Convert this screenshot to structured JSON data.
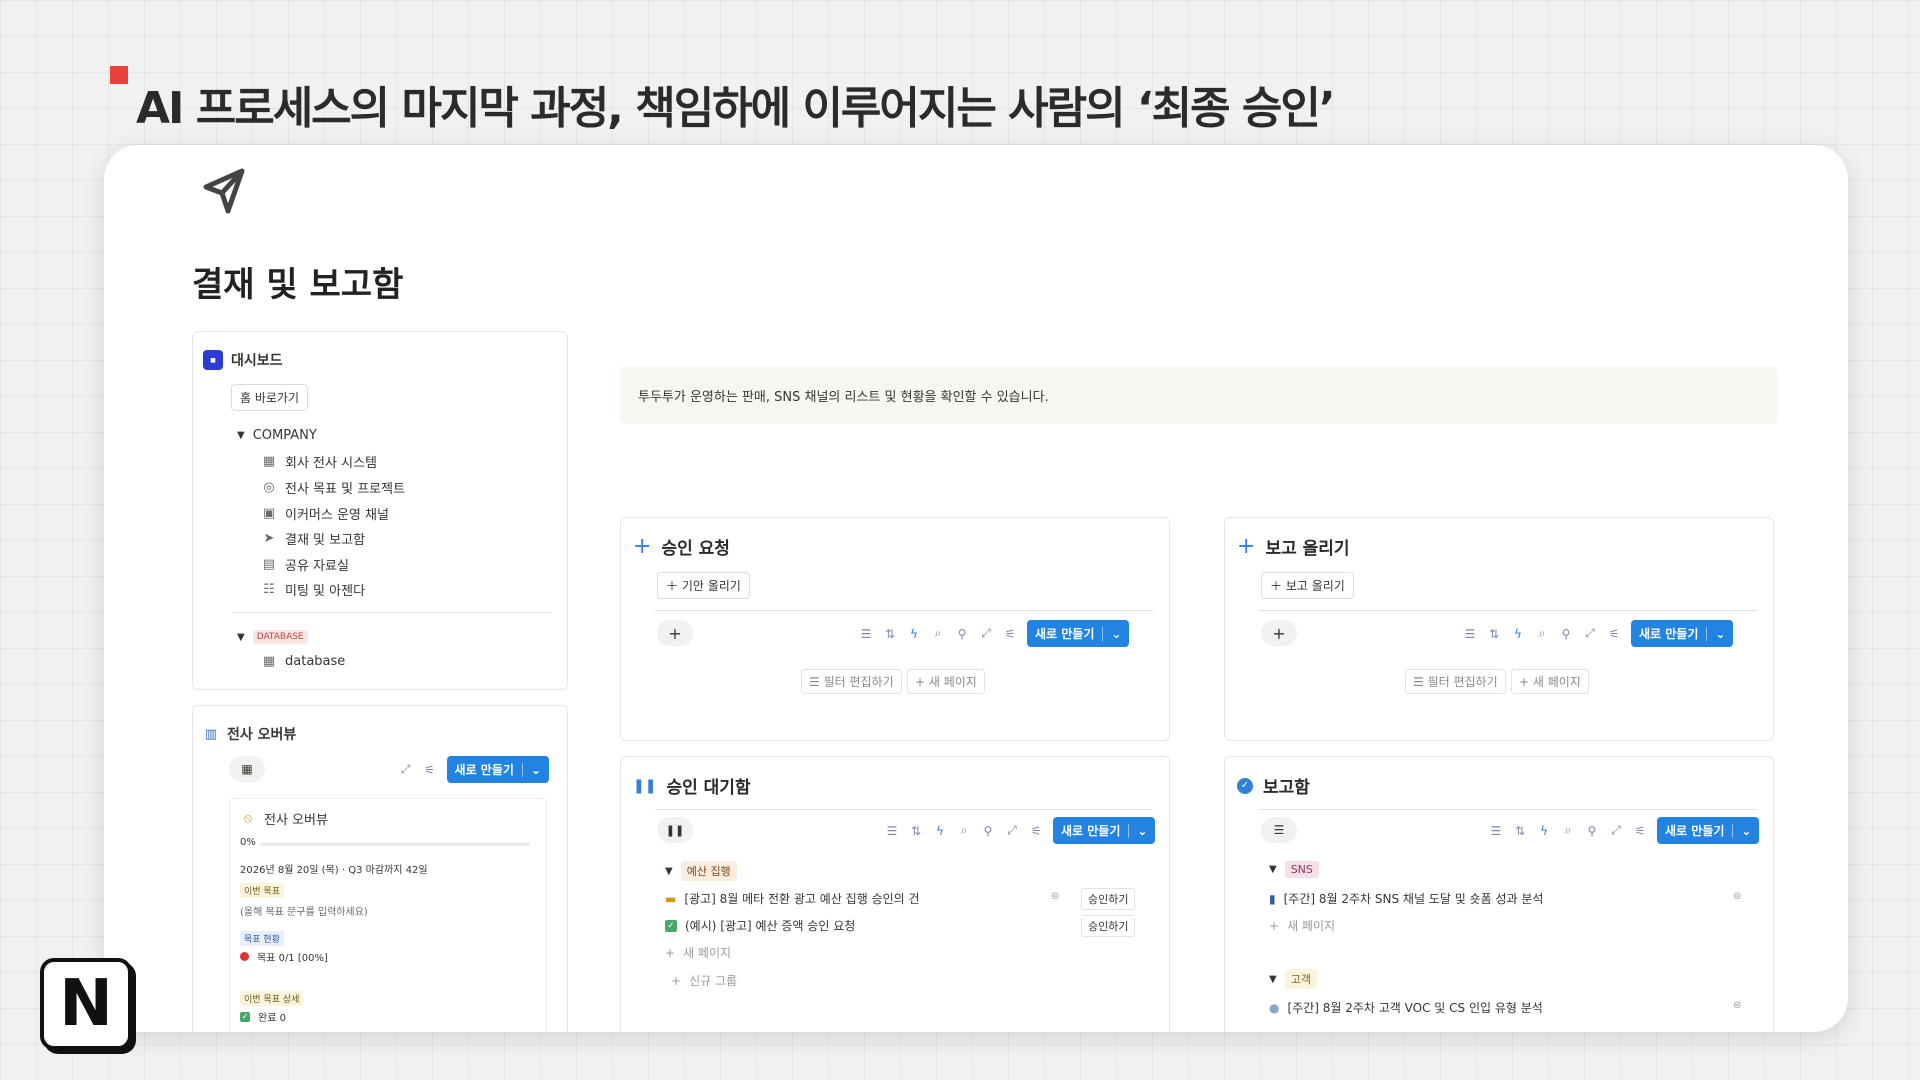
{
  "headline": "AI 프로세스의 마지막 과정, 책임하에 이루어지는 사람의 ‘최종 승인’",
  "page": {
    "icon": "paper-plane-icon",
    "title": "결재 및 보고함"
  },
  "sidebar": {
    "dashboard_label": "대시보드",
    "home_button": "홈 바로가기",
    "company_group": "COMPANY",
    "company_items": [
      {
        "icon": "building-icon",
        "label": "회사 전사 시스템"
      },
      {
        "icon": "target-icon",
        "label": "전사 목표 및 프로젝트"
      },
      {
        "icon": "monitor-icon",
        "label": "이커머스 운영 채널"
      },
      {
        "icon": "paper-plane-icon",
        "label": "결재 및 보고함"
      },
      {
        "icon": "folder-icon",
        "label": "공유 자료실"
      },
      {
        "icon": "people-icon",
        "label": "미팅 및 아젠다"
      }
    ],
    "database_group": "DATABASE",
    "database_item": "database"
  },
  "overview": {
    "title": "전사 오버뷰",
    "new_button": "새로 만들기",
    "card_title": "전사 오버뷰",
    "progress_text": "0%",
    "progress": 0,
    "date_line": "2026년 8월 20일 (목) · Q3 마감까지 42일",
    "goal_label": "이번 목표",
    "goal_placeholder": "(올해 목표 문구를 입력하세요)",
    "status_label": "목표 현황",
    "status_value": "목표 0/1 [00%]",
    "detail_label": "이번 목표 상세",
    "done_value": "완료 0"
  },
  "description": "투두투가 운영하는 판매, SNS 채널의 리스트 및 현황을 확인할 수 있습니다.",
  "panels": {
    "request": {
      "title": "승인 요청",
      "action": "기안 올리기",
      "new_button": "새로 만들기",
      "filter_edit": "필터 편집하기",
      "new_page": "새 페이지"
    },
    "report_up": {
      "title": "보고 올리기",
      "action": "보고 올리기",
      "new_button": "새로 만들기",
      "filter_edit": "필터 편집하기",
      "new_page": "새 페이지"
    },
    "waiting": {
      "title": "승인 대기함",
      "new_button": "새로 만들기",
      "group": "예산 집행",
      "items": [
        {
          "label": "[광고] 8월 메타 전환 광고 예산 집행 승인의 건",
          "action": "승인하기"
        },
        {
          "label": "(예시) [광고] 예산 증액 승인 요청",
          "action": "승인하기"
        }
      ],
      "new_page": "새 페이지",
      "new_group": "신규 그룹"
    },
    "reports": {
      "title": "보고함",
      "new_button": "새로 만들기",
      "group1": "SNS",
      "group1_item": "[주간] 8월 2주차 SNS 채널 도달 및 숏폼 성과 분석",
      "new_page": "새 페이지",
      "group2": "고객",
      "group2_item": "[주간] 8월 2주차 고객 VOC 및 CS 인입 유형 분석"
    }
  },
  "logo_text": "N"
}
